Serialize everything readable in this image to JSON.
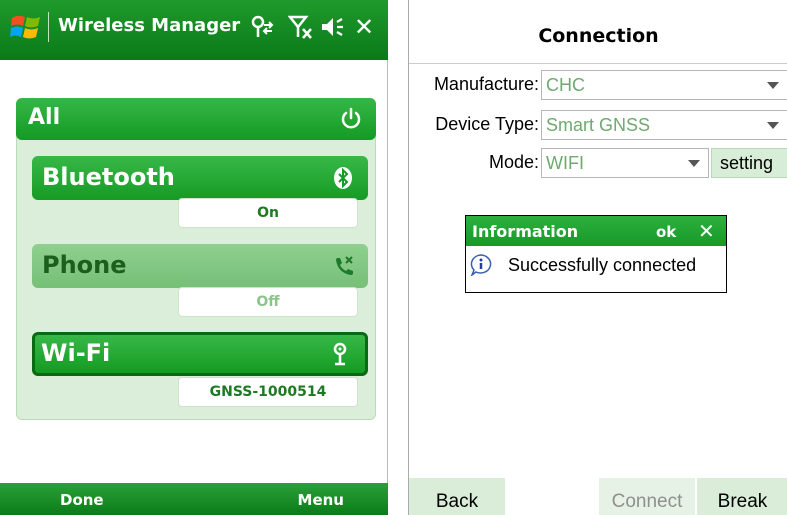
{
  "left": {
    "title_bar": {
      "title": "Wireless Manager",
      "close_glyph": "✕",
      "icons": [
        "windows-logo-icon",
        "wireless-icon",
        "no-signal-icon",
        "volume-icon",
        "close-icon"
      ]
    },
    "all": {
      "label": "All",
      "icon": "power-icon"
    },
    "radios": [
      {
        "label": "Bluetooth",
        "status": "On",
        "icon": "bluetooth-icon"
      },
      {
        "label": "Phone",
        "status": "Off",
        "icon": "phone-off-icon"
      },
      {
        "label": "Wi-Fi",
        "status": "GNSS-1000514",
        "icon": "wifi-antenna-icon",
        "selected": true
      }
    ],
    "softkeys": {
      "left": "Done",
      "right": "Menu"
    },
    "colors": {
      "accent": "#159a25",
      "panel": "#daeed9",
      "inactive": "#8fcf8f"
    }
  },
  "right": {
    "title": "Connection",
    "fields": {
      "manufacture": {
        "label": "Manufacture:",
        "value": "CHC"
      },
      "device_type": {
        "label": "Device Type:",
        "value": "Smart GNSS"
      },
      "mode": {
        "label": "Mode:",
        "value": "WIFI"
      }
    },
    "setting_label": "setting",
    "dialog": {
      "title": "Information",
      "ok": "ok",
      "close_glyph": "✕",
      "message": "Successfully connected",
      "icon": "info-icon"
    },
    "buttons": {
      "back": "Back",
      "connect": "Connect",
      "break": "Break"
    }
  }
}
